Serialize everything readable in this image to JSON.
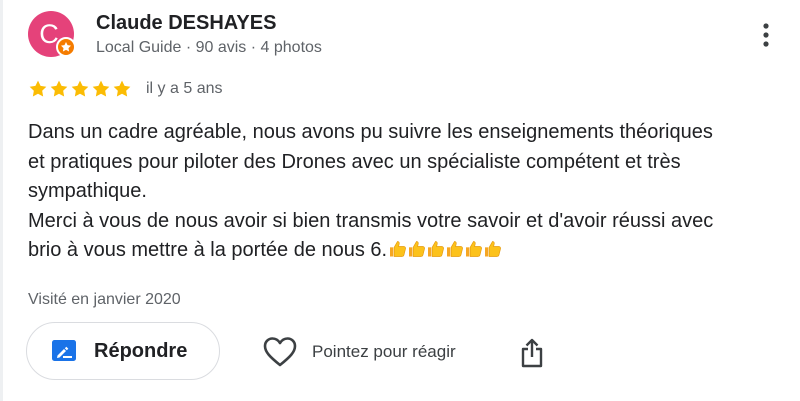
{
  "reviewer": {
    "initial": "C",
    "name": "Claude DESHAYES",
    "meta": "Local Guide · 90 avis · 4 photos",
    "avatar_color": "#e5427a",
    "badge_color": "#f57c00",
    "badge_icon": "star-icon"
  },
  "review": {
    "rating": 5,
    "max_rating": 5,
    "star_color": "#fbbc04",
    "date": "il y a 5 ans",
    "text_line1": "Dans un cadre agréable, nous avons pu suivre les enseignements théoriques",
    "text_line2": "et pratiques pour piloter des Drones avec un spécialiste compétent et très",
    "text_line3": "sympathique.",
    "text_line4": "Merci à vous de nous avoir si bien transmis votre savoir et d'avoir réussi avec",
    "text_line5": "brio à vous mettre à la portée de nous 6.",
    "emoji": "thumbs-up-icon",
    "emoji_count": 6,
    "visit": "Visité en janvier 2020"
  },
  "actions": {
    "reply_label": "Répondre",
    "reply_icon": "edit-reply-icon",
    "react_label": "Pointez pour réagir",
    "react_icon": "heart-icon",
    "share_icon": "share-icon",
    "menu_icon": "more-vert-icon",
    "accent_color": "#1a73e8"
  }
}
